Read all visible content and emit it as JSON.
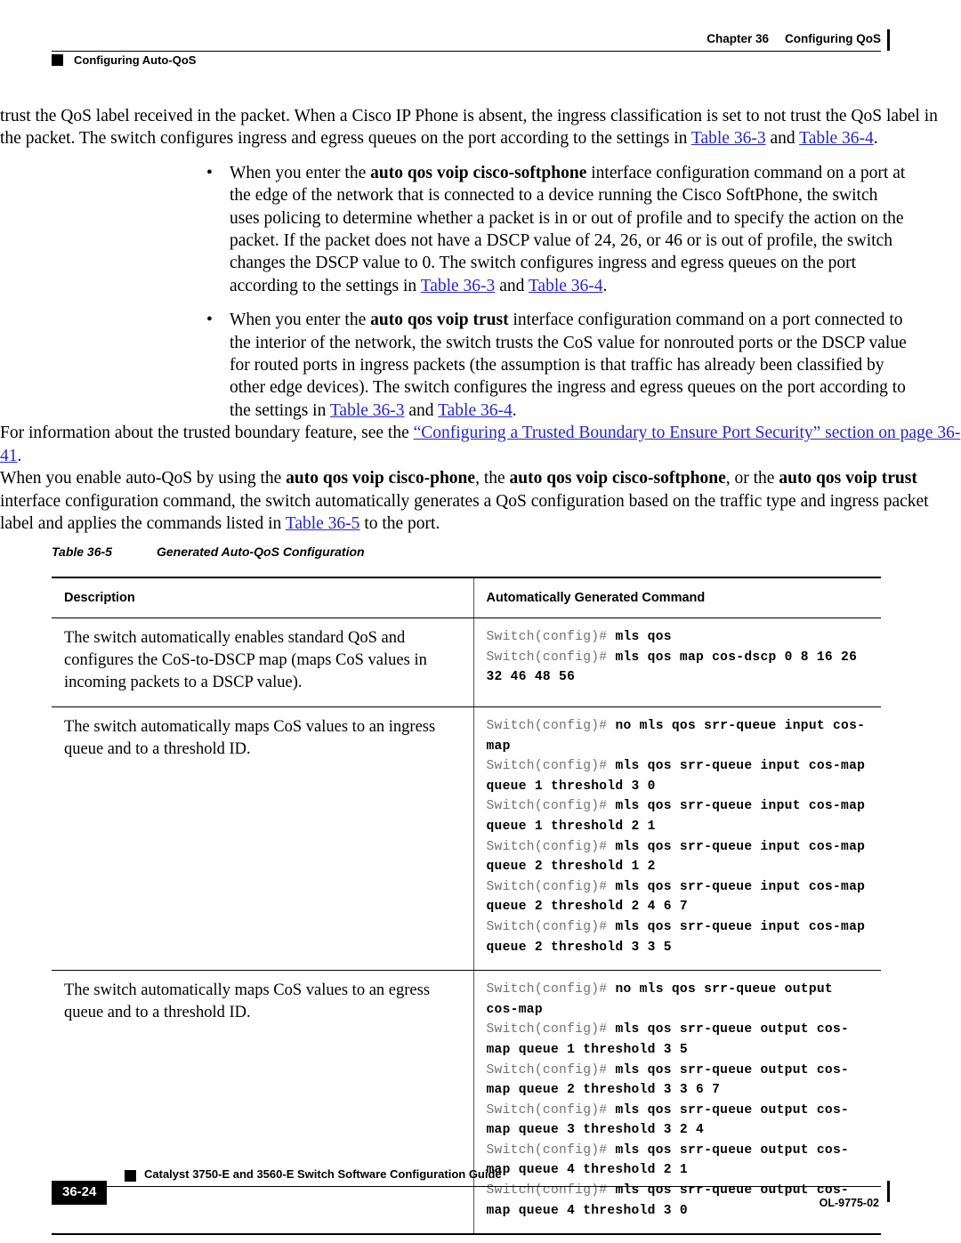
{
  "header": {
    "chapter": "Chapter 36",
    "chapter_title": "Configuring QoS",
    "section": "Configuring Auto-QoS"
  },
  "body": {
    "para_1_line_1": "trust the QoS label received in the packet. When a Cisco IP Phone is absent, the ingress",
    "para_1_line_2": "classification is set to not trust the QoS label in the packet. The switch configures ingress and egress",
    "para_1_line_3a": "queues on the port according to the settings in ",
    "para_1_link_a": "Table 36-3",
    "para_1_mid": " and ",
    "para_1_link_b": "Table 36-4",
    "para_1_end": ".",
    "bullet_mark": "•",
    "bullet_1": {
      "pre": "When you enter the ",
      "cmd": "auto qos voip cisco-softphone",
      "post": " interface configuration command on a port at the edge of the network that is connected to a device running the Cisco SoftPhone, the switch uses policing to determine whether a packet is in or out of profile and to specify the action on the packet. If the packet does not have a DSCP value of 24, 26, or 46 or is out of profile, the switch changes the DSCP value to 0. The switch configures ingress and egress queues on the port according to the settings in ",
      "link_a": "Table 36-3",
      "mid": " and ",
      "link_b": "Table 36-4",
      "end": "."
    },
    "bullet_2": {
      "pre": "When you enter the ",
      "cmd": "auto qos voip trust",
      "post": " interface configuration command on a port connected to the interior of the network, the switch trusts the CoS value for nonrouted ports or the DSCP value for routed ports in ingress packets (the assumption is that traffic has already been classified by other edge devices). The switch configures the ingress and egress queues on the port according to the settings in ",
      "link_a": "Table 36-3",
      "mid": " and ",
      "link_b": "Table 36-4",
      "end": "."
    },
    "para_xref": {
      "pre": "For information about the trusted boundary feature, see the ",
      "link": "“Configuring a Trusted Boundary to Ensure Port Security” section on page 36-41",
      "end": "."
    },
    "para_summary": {
      "s1": "When you enable auto-QoS by using the ",
      "c1": "auto qos voip cisco-phone",
      "s2": ", the ",
      "c2": "auto qos voip cisco-softphone",
      "s3": ", or the ",
      "c3": "auto qos voip trust",
      "s4": " interface configuration command, the switch automatically generates a QoS configuration based on the traffic type and ingress packet label and applies the commands listed in ",
      "link": "Table 36-5",
      "s5": " to the port."
    }
  },
  "table": {
    "caption_number": "Table 36-5",
    "caption_title": "Generated Auto-QoS Configuration",
    "columns": [
      "Description",
      "Automatically Generated Command"
    ],
    "rows": [
      {
        "description": "The switch automatically enables standard QoS and configures the CoS-to-DSCP map (maps CoS values in incoming packets to a DSCP value).",
        "lines": [
          {
            "prompt": "Switch(config)# ",
            "command": "mls qos"
          },
          {
            "prompt": "Switch(config)# ",
            "command": "mls qos map cos-dscp 0 8 16 26 32 46 48 56"
          }
        ]
      },
      {
        "description": "The switch automatically maps CoS values to an ingress queue and to a threshold ID.",
        "lines": [
          {
            "prompt": "Switch(config)# ",
            "command": "no mls qos srr-queue input cos-map"
          },
          {
            "prompt": "Switch(config)# ",
            "command": "mls qos srr-queue input cos-map queue 1 threshold 3 0"
          },
          {
            "prompt": "Switch(config)# ",
            "command": "mls qos srr-queue input cos-map queue 1 threshold 2 1"
          },
          {
            "prompt": "Switch(config)# ",
            "command": "mls qos srr-queue input cos-map queue 2 threshold 1 2"
          },
          {
            "prompt": "Switch(config)# ",
            "command": "mls qos srr-queue input cos-map queue 2 threshold 2 4 6 7"
          },
          {
            "prompt": "Switch(config)# ",
            "command": "mls qos srr-queue input cos-map queue 2 threshold 3 3 5"
          }
        ]
      },
      {
        "description": "The switch automatically maps CoS values to an egress queue and to a threshold ID.",
        "lines": [
          {
            "prompt": "Switch(config)# ",
            "command": "no mls qos srr-queue output cos-map"
          },
          {
            "prompt": "Switch(config)# ",
            "command": "mls qos srr-queue output cos-map queue 1 threshold 3 5"
          },
          {
            "prompt": "Switch(config)# ",
            "command": "mls qos srr-queue output cos-map queue 2 threshold 3 3 6 7"
          },
          {
            "prompt": "Switch(config)# ",
            "command": "mls qos srr-queue output cos-map queue 3 threshold 3 2 4"
          },
          {
            "prompt": "Switch(config)# ",
            "command": "mls qos srr-queue output cos-map queue 4 threshold 2 1"
          },
          {
            "prompt": "Switch(config)# ",
            "command": "mls qos srr-queue output cos-map queue 4 threshold 3 0"
          }
        ]
      }
    ]
  },
  "footer": {
    "page_number": "36-24",
    "document_title": "Catalyst 3750-E and 3560-E Switch Software Configuration Guide",
    "doc_id": "OL-9775-02"
  }
}
